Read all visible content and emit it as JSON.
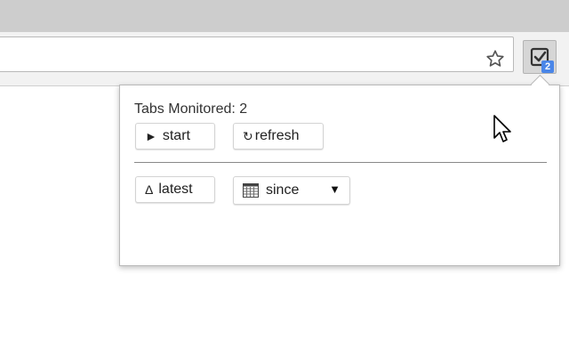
{
  "browser": {
    "extension_badge": "2",
    "icons": {
      "star": "star-outline-icon",
      "extension": "checkbox-icon"
    }
  },
  "popup": {
    "tabs_monitored": "Tabs Monitored: 2",
    "start_label": "start",
    "start_glyph": "►",
    "refresh_label": "refresh",
    "refresh_glyph": "↻",
    "latest_label": "latest",
    "latest_glyph": "Δ",
    "since_label": "since",
    "since_arrow": "▼"
  },
  "colors": {
    "badge": "#4a86e8",
    "titlebar": "#cdcdcd",
    "toolbar": "#f2f2f2"
  }
}
